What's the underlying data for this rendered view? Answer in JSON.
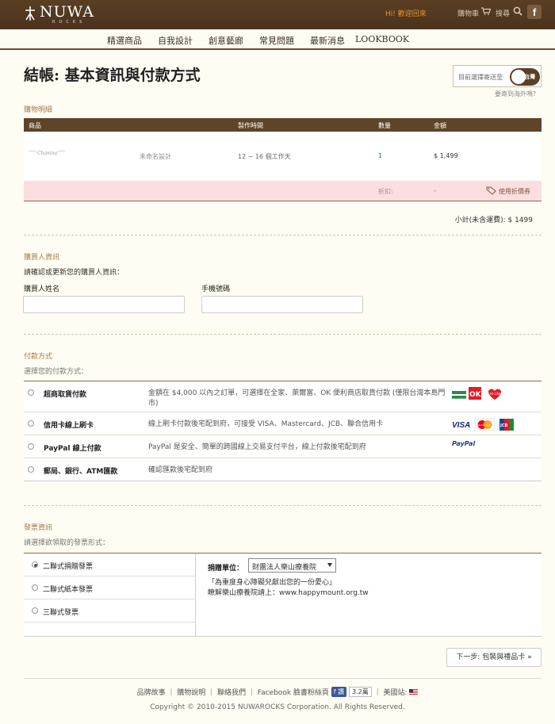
{
  "header": {
    "logo_name": "NUWA",
    "logo_sub": "ROCKS",
    "greeting": "Hi! 歡迎回來",
    "cart": "購物車",
    "search": "搜尋",
    "facebook": "f"
  },
  "nav": [
    "精選商品",
    "自我設計",
    "創意藝廊",
    "常見問題",
    "最新消息",
    "LOOKBOOK"
  ],
  "page_title": "結帳: 基本資訊與付款方式",
  "country": {
    "label": "目前選擇寄送至",
    "value": "台灣",
    "abroad": "要寄到海外嗎？"
  },
  "cart_section": {
    "label": "購物明細",
    "headers": {
      "product": "商品",
      "production": "製作時間",
      "qty": "數量",
      "amount": "金額"
    },
    "item": {
      "thumb_text": "Chanina",
      "name": "未命名設計",
      "production": "12 ~ 16 個工作天",
      "qty": "1",
      "amount": "$ 1,499"
    },
    "discount": {
      "label": "折扣:",
      "value": "-",
      "coupon": "使用折價券"
    },
    "subtotal": "小計(未含運費): $ 1499"
  },
  "buyer": {
    "label": "購買人資訊",
    "hint": "請確認或更新您的購買人資訊：",
    "name_label": "購買人姓名",
    "phone_label": "手機號碼",
    "name_value": "",
    "phone_value": ""
  },
  "payment": {
    "label": "付款方式",
    "hint": "選擇您的付款方式：",
    "options": [
      {
        "name": "超商取貨付款",
        "desc": "金額在 $4,000 以內之訂單，可選擇在全家、萊爾富、OK 便利商店取貨付款 (僅限台灣本島門市)"
      },
      {
        "name": "信用卡線上刷卡",
        "desc": "線上刷卡付款後宅配到府，可接受 VISA、Mastercard、JCB、聯合信用卡"
      },
      {
        "name": "PayPal 線上付款",
        "desc": "PayPal 是安全、簡單的跨國線上交易支付平台，線上付款後宅配到府"
      },
      {
        "name": "郵局、銀行、ATM匯款",
        "desc": "確認匯款後宅配到府"
      }
    ],
    "logos": {
      "visa": "VISA",
      "mastercard": "MasterCard",
      "jcb": "JCB",
      "paypal": "PayPal",
      "ok": "OK",
      "familymart": "FamilyMart",
      "hilife": "Hi-Life"
    }
  },
  "invoice": {
    "label": "發票資訊",
    "hint": "請選擇欲領取的發票形式：",
    "options": [
      "二聯式捐贈發票",
      "二聯式紙本發票",
      "三聯式發票"
    ],
    "donate_label": "捐贈單位：",
    "donate_value": "財團法人樂山療養院",
    "donate_quote": "「為重度身心障礙兒獻出您的一份愛心」",
    "donate_link": "瞭解樂山療養院請上：www.happymount.org.tw"
  },
  "next_button": "下一步: 包裝與禮品卡 »",
  "footer": {
    "links": "品牌故事 ｜ 購物說明 ｜ 聯絡我們 ｜ Facebook 臉書粉絲頁",
    "like": "讚",
    "like_count": "3.2萬",
    "us_site": "｜ 美國站:",
    "copyright": "Copyright © 2010-2015 NUWAROCKS Corporation. All Rights Reserved."
  }
}
